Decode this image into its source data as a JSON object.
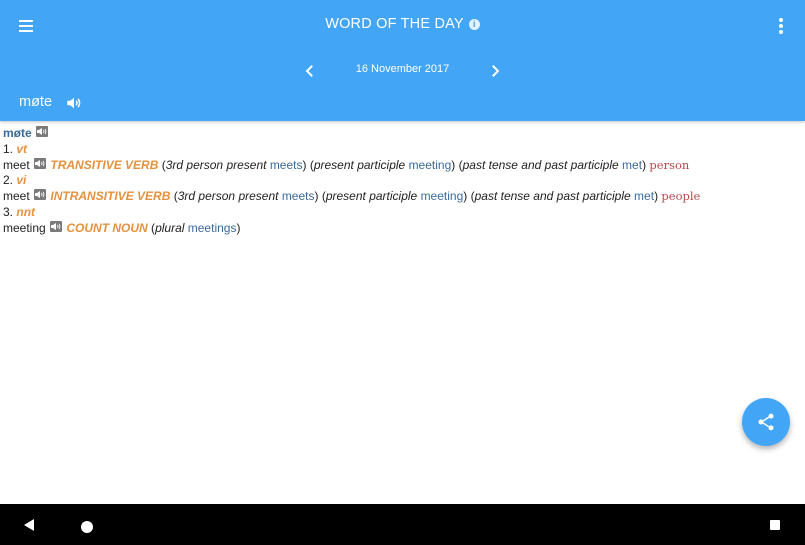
{
  "appbar": {
    "title": "WORD OF THE DAY",
    "info_glyph": "i",
    "date": "16 November 2017",
    "word": "møte",
    "background": "#42a5f5"
  },
  "entry": {
    "headword": "møte",
    "senses": [
      {
        "num": "1.",
        "abbr": "vt",
        "translation": "meet",
        "pos": "TRANSITIVE VERB",
        "f1_label": "3rd person present",
        "f1_value": "meets",
        "f2_label": "present participle",
        "f2_value": "meeting",
        "f3_label": "past tense and past participle",
        "f3_value": "met",
        "note": "person"
      },
      {
        "num": "2.",
        "abbr": "vi",
        "translation": "meet",
        "pos": "INTRANSITIVE VERB",
        "f1_label": "3rd person present",
        "f1_value": "meets",
        "f2_label": "present participle",
        "f2_value": "meeting",
        "f3_label": "past tense and past participle",
        "f3_value": "met",
        "note": "people"
      },
      {
        "num": "3.",
        "abbr": "nnt",
        "translation": "meeting",
        "pos": "COUNT NOUN",
        "f1_label": "plural",
        "f1_value": "meetings"
      }
    ]
  },
  "icons": {
    "menu": "menu-icon",
    "more": "more-vert-icon",
    "prev": "chevron-left-icon",
    "next": "chevron-right-icon",
    "speaker": "speaker-icon",
    "share": "share-icon"
  },
  "colors": {
    "link": "#3a6a9c",
    "pos": "#e6913d",
    "note": "#b7474a"
  }
}
